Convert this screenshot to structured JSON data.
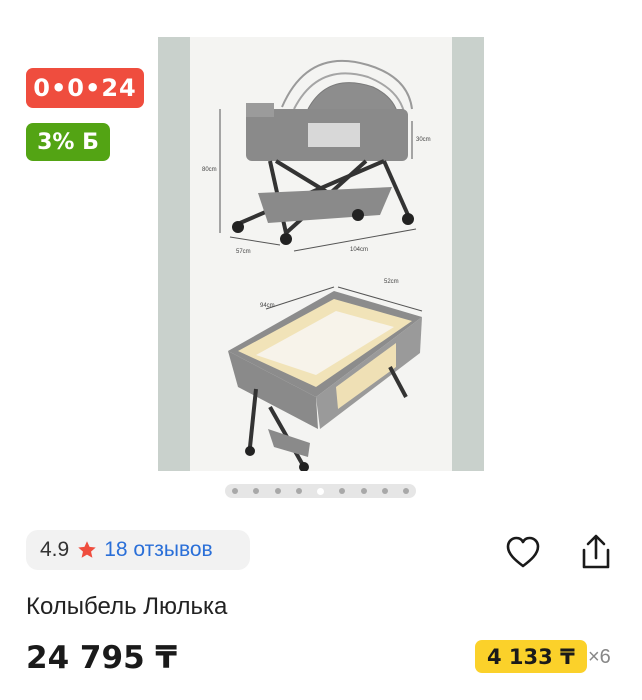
{
  "badges": {
    "timer": "0•0•24",
    "bonus": "3% Б"
  },
  "gallery": {
    "dot_count": 9,
    "active_index": 4,
    "dimensions": {
      "height_total": "80cm",
      "height_side": "30cm",
      "width": "57cm",
      "length": "104cm",
      "inner_length": "94cm",
      "inner_width": "52cm"
    }
  },
  "rating": {
    "value": "4.9",
    "reviews": "18 отзывов"
  },
  "product": {
    "title": "Колыбель Люлька",
    "price": "24 795 ₸"
  },
  "installment": {
    "amount": "4 133 ₸",
    "months": "×6"
  },
  "colors": {
    "timer_bg": "#ef4d3e",
    "bonus_bg": "#53a414",
    "installment_bg": "#fbd12a",
    "link": "#2a6fd8",
    "star": "#ef4d3e"
  }
}
